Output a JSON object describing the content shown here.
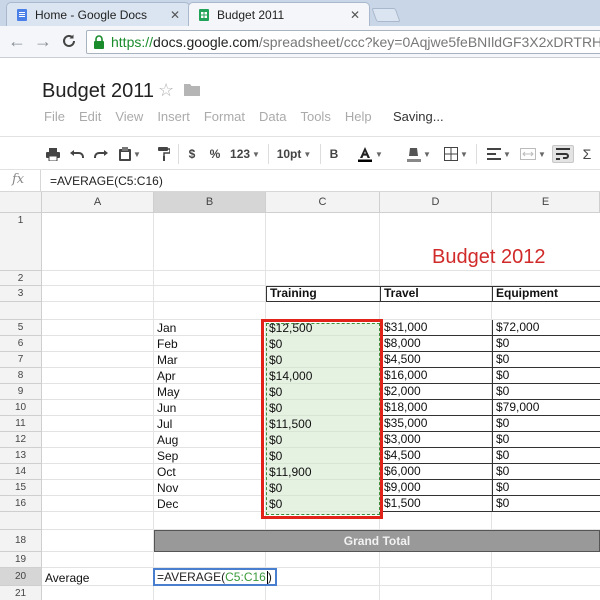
{
  "browser": {
    "tabs": [
      {
        "label": "Home - Google Docs",
        "active": false
      },
      {
        "label": "Budget 2011",
        "active": true
      }
    ],
    "url": {
      "scheme": "https://",
      "host": "docs.google.com",
      "path": "/spreadsheet/ccc?key=0Aqjwe5feBNIldGF3X2xDRTRHR"
    }
  },
  "doc": {
    "title": "Budget 2011",
    "menu": [
      "File",
      "Edit",
      "View",
      "Insert",
      "Format",
      "Data",
      "Tools",
      "Help"
    ],
    "status": "Saving..."
  },
  "toolbar": {
    "dollar": "$",
    "percent": "%",
    "number_format": "123",
    "font_size": "10pt",
    "bold": "B",
    "sum": "Σ"
  },
  "formula_bar": {
    "icon": "fx",
    "formula": "=AVERAGE(C5:C16)"
  },
  "grid": {
    "columns": [
      "A",
      "B",
      "C",
      "D",
      "E"
    ],
    "rows": [
      "1",
      "2",
      "3",
      "",
      "5",
      "6",
      "7",
      "8",
      "9",
      "10",
      "11",
      "12",
      "13",
      "14",
      "15",
      "16",
      "",
      "18",
      "19",
      "20",
      "21"
    ],
    "title": "Budget 2012",
    "headers": [
      "Training",
      "Travel",
      "Equipment"
    ],
    "months": [
      "Jan",
      "Feb",
      "Mar",
      "Apr",
      "May",
      "Jun",
      "Jul",
      "Aug",
      "Sep",
      "Oct",
      "Nov",
      "Dec"
    ],
    "training": [
      "$12,500",
      "$0",
      "$0",
      "$14,000",
      "$0",
      "$0",
      "$11,500",
      "$0",
      "$0",
      "$11,900",
      "$0",
      "$0"
    ],
    "travel": [
      "$31,000",
      "$8,000",
      "$4,500",
      "$16,000",
      "$2,000",
      "$18,000",
      "$35,000",
      "$3,000",
      "$4,500",
      "$6,000",
      "$9,000",
      "$1,500"
    ],
    "equipment": [
      "$72,000",
      "$0",
      "$0",
      "$0",
      "$0",
      "$79,000",
      "$0",
      "$0",
      "$0",
      "$0",
      "$0",
      "$0"
    ],
    "grand_total": "Grand Total",
    "average_label": "Average",
    "edit": {
      "prefix": "=AVERAGE(",
      "range": "C5:C16",
      "suffix": ")"
    }
  },
  "colors": {
    "title_red": "#d12a2a",
    "highlight_box": "#e2231a",
    "range_green": "#3a9a3a",
    "edit_border": "#4a7fd0"
  }
}
